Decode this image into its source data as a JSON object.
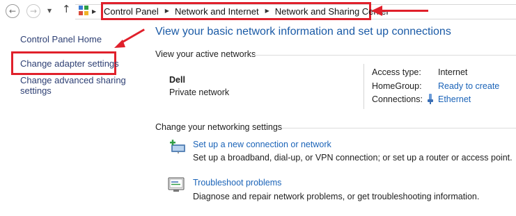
{
  "nav": {
    "back_icon": "back-arrow-icon",
    "forward_icon": "forward-arrow-icon",
    "recent_icon": "dropdown-chevron-icon",
    "up_icon": "up-arrow-icon",
    "location_icon": "control-panel-icon"
  },
  "breadcrumb": {
    "items": [
      "Control Panel",
      "Network and Internet",
      "Network and Sharing Center"
    ]
  },
  "sidebar": {
    "home": "Control Panel Home",
    "adapter": "Change adapter settings",
    "advanced_line1": "Change advanced sharing",
    "advanced_line2": "settings"
  },
  "main": {
    "title": "View your basic network information and set up connections",
    "active_networks": {
      "heading": "View your active networks",
      "name": "Dell",
      "category": "Private network",
      "access_type_label": "Access type:",
      "access_type_value": "Internet",
      "homegroup_label": "HomeGroup:",
      "homegroup_value": "Ready to create",
      "connections_label": "Connections:",
      "connections_value": "Ethernet"
    },
    "settings": {
      "heading": "Change your networking settings",
      "items": [
        {
          "link": "Set up a new connection or network",
          "description": "Set up a broadband, dial-up, or VPN connection; or set up a router or access point.",
          "icon": "new-connection-icon"
        },
        {
          "link": "Troubleshoot problems",
          "description": "Diagnose and repair network problems, or get troubleshooting information.",
          "icon": "troubleshoot-icon"
        }
      ]
    }
  },
  "colors": {
    "annotation_red": "#e0202b",
    "link_blue": "#1a63b8",
    "title_blue": "#1a5aa6",
    "sidebar_link": "#2d3f73"
  }
}
